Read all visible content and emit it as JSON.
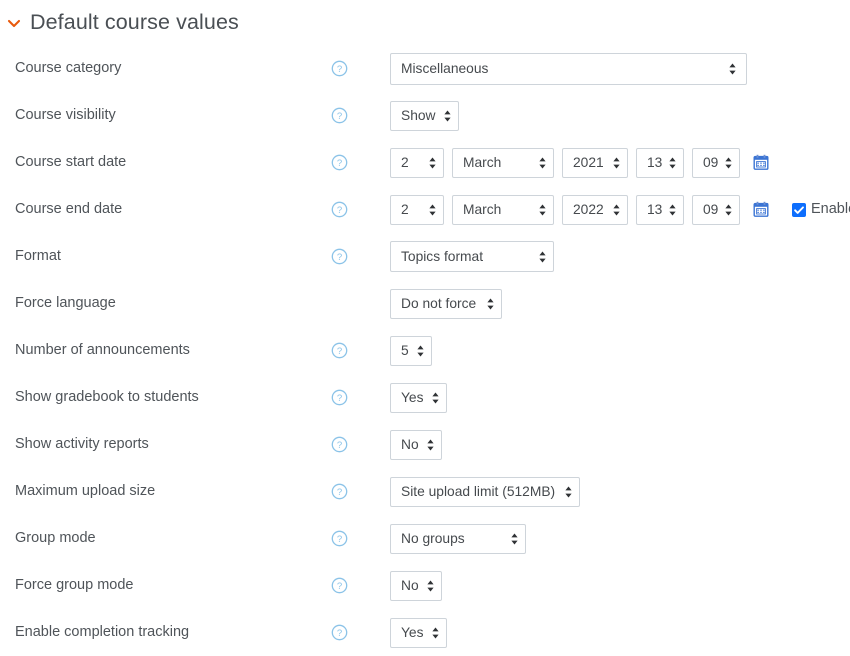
{
  "section": {
    "title": "Default course values",
    "collapse_icon": "chevron-down-icon",
    "collapse_color": "#e8590c"
  },
  "theme": {
    "label_color": "#4f5459",
    "border_color": "#ced4da",
    "help_icon_color": "#8bc3e8",
    "calendar_icon_color": "#3b74d4",
    "checkbox_checked_color": "#0d6efd"
  },
  "help_icon": {
    "glyph": "?",
    "name": "help-icon"
  },
  "rows": [
    {
      "id": "course-category",
      "label": "Course category",
      "has_help": true,
      "control": "select",
      "value": "Miscellaneous"
    },
    {
      "id": "course-visibility",
      "label": "Course visibility",
      "has_help": true,
      "control": "select",
      "value": "Show"
    },
    {
      "id": "course-start-date",
      "label": "Course start date",
      "has_help": true,
      "control": "date",
      "day": "2",
      "month": "March",
      "year": "2021",
      "hour": "13",
      "minute": "09",
      "calendar_icon": "calendar-icon",
      "has_enable": false
    },
    {
      "id": "course-end-date",
      "label": "Course end date",
      "has_help": true,
      "control": "date",
      "day": "2",
      "month": "March",
      "year": "2022",
      "hour": "13",
      "minute": "09",
      "calendar_icon": "calendar-icon",
      "has_enable": true,
      "enable_label": "Enable",
      "enable_checked": true
    },
    {
      "id": "format",
      "label": "Format",
      "has_help": true,
      "control": "select",
      "value": "Topics format"
    },
    {
      "id": "force-language",
      "label": "Force language",
      "has_help": false,
      "control": "select",
      "value": "Do not force"
    },
    {
      "id": "number-of-announcements",
      "label": "Number of announcements",
      "has_help": true,
      "control": "select",
      "value": "5"
    },
    {
      "id": "show-gradebook-to-students",
      "label": "Show gradebook to students",
      "has_help": true,
      "control": "select",
      "value": "Yes"
    },
    {
      "id": "show-activity-reports",
      "label": "Show activity reports",
      "has_help": true,
      "control": "select",
      "value": "No"
    },
    {
      "id": "maximum-upload-size",
      "label": "Maximum upload size",
      "has_help": true,
      "control": "select",
      "value": "Site upload limit (512MB)"
    },
    {
      "id": "group-mode",
      "label": "Group mode",
      "has_help": true,
      "control": "select",
      "value": "No groups"
    },
    {
      "id": "force-group-mode",
      "label": "Force group mode",
      "has_help": true,
      "control": "select",
      "value": "No"
    },
    {
      "id": "enable-completion-tracking",
      "label": "Enable completion tracking",
      "has_help": true,
      "control": "select",
      "value": "Yes"
    }
  ]
}
